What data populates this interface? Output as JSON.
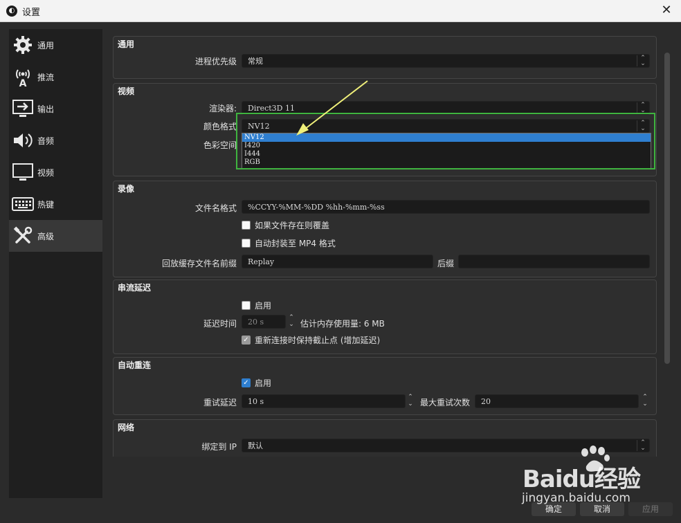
{
  "window": {
    "title": "设置",
    "close": "✕"
  },
  "sidebar": {
    "items": [
      {
        "label": "通用",
        "icon": "gear-icon"
      },
      {
        "label": "推流",
        "icon": "broadcast-icon"
      },
      {
        "label": "输出",
        "icon": "output-icon"
      },
      {
        "label": "音频",
        "icon": "speaker-icon"
      },
      {
        "label": "视频",
        "icon": "monitor-icon"
      },
      {
        "label": "热键",
        "icon": "keyboard-icon"
      },
      {
        "label": "高级",
        "icon": "tools-icon",
        "active": true
      }
    ]
  },
  "general": {
    "title": "通用",
    "priority_label": "进程优先级",
    "priority_value": "常规"
  },
  "video": {
    "title": "视频",
    "renderer_label": "渲染器:",
    "renderer_value": "Direct3D 11",
    "color_format_label": "颜色格式",
    "color_format_value": "NV12",
    "color_space_label": "色彩空间",
    "options": [
      "NV12",
      "I420",
      "I444",
      "RGB"
    ],
    "selected_option": "NV12"
  },
  "recording": {
    "title": "录像",
    "filename_label": "文件名格式",
    "filename_value": "%CCYY-%MM-%DD %hh-%mm-%ss",
    "overwrite_label": "如果文件存在则覆盖",
    "overwrite_checked": false,
    "remux_label": "自动封装至 MP4 格式",
    "remux_checked": false,
    "replay_prefix_label": "回放缓存文件名前缀",
    "replay_prefix_value": "Replay",
    "suffix_label": "后缀",
    "suffix_value": ""
  },
  "stream_delay": {
    "title": "串流延迟",
    "enable_label": "启用",
    "enable_checked": false,
    "delay_label": "延迟时间",
    "delay_value": "20 s",
    "memory_label": "估计内存使用量: 6 MB",
    "preserve_label": "重新连接时保持截止点 (增加延迟)",
    "preserve_checked": true
  },
  "auto_reconnect": {
    "title": "自动重连",
    "enable_label": "启用",
    "enable_checked": true,
    "retry_delay_label": "重试延迟",
    "retry_delay_value": "10 s",
    "max_retries_label": "最大重试次数",
    "max_retries_value": "20"
  },
  "network": {
    "title": "网络",
    "bind_ip_label": "绑定到 IP",
    "bind_ip_value": "默认"
  },
  "buttons": {
    "ok": "确定",
    "cancel": "取消",
    "apply": "应用"
  },
  "watermark": {
    "logo": "Baidu经验",
    "url": "jingyan.baidu.com"
  },
  "colors": {
    "accent": "#2f7fd0",
    "highlight_box": "#3fb43f",
    "annotation_arrow": "#f0f07a"
  }
}
